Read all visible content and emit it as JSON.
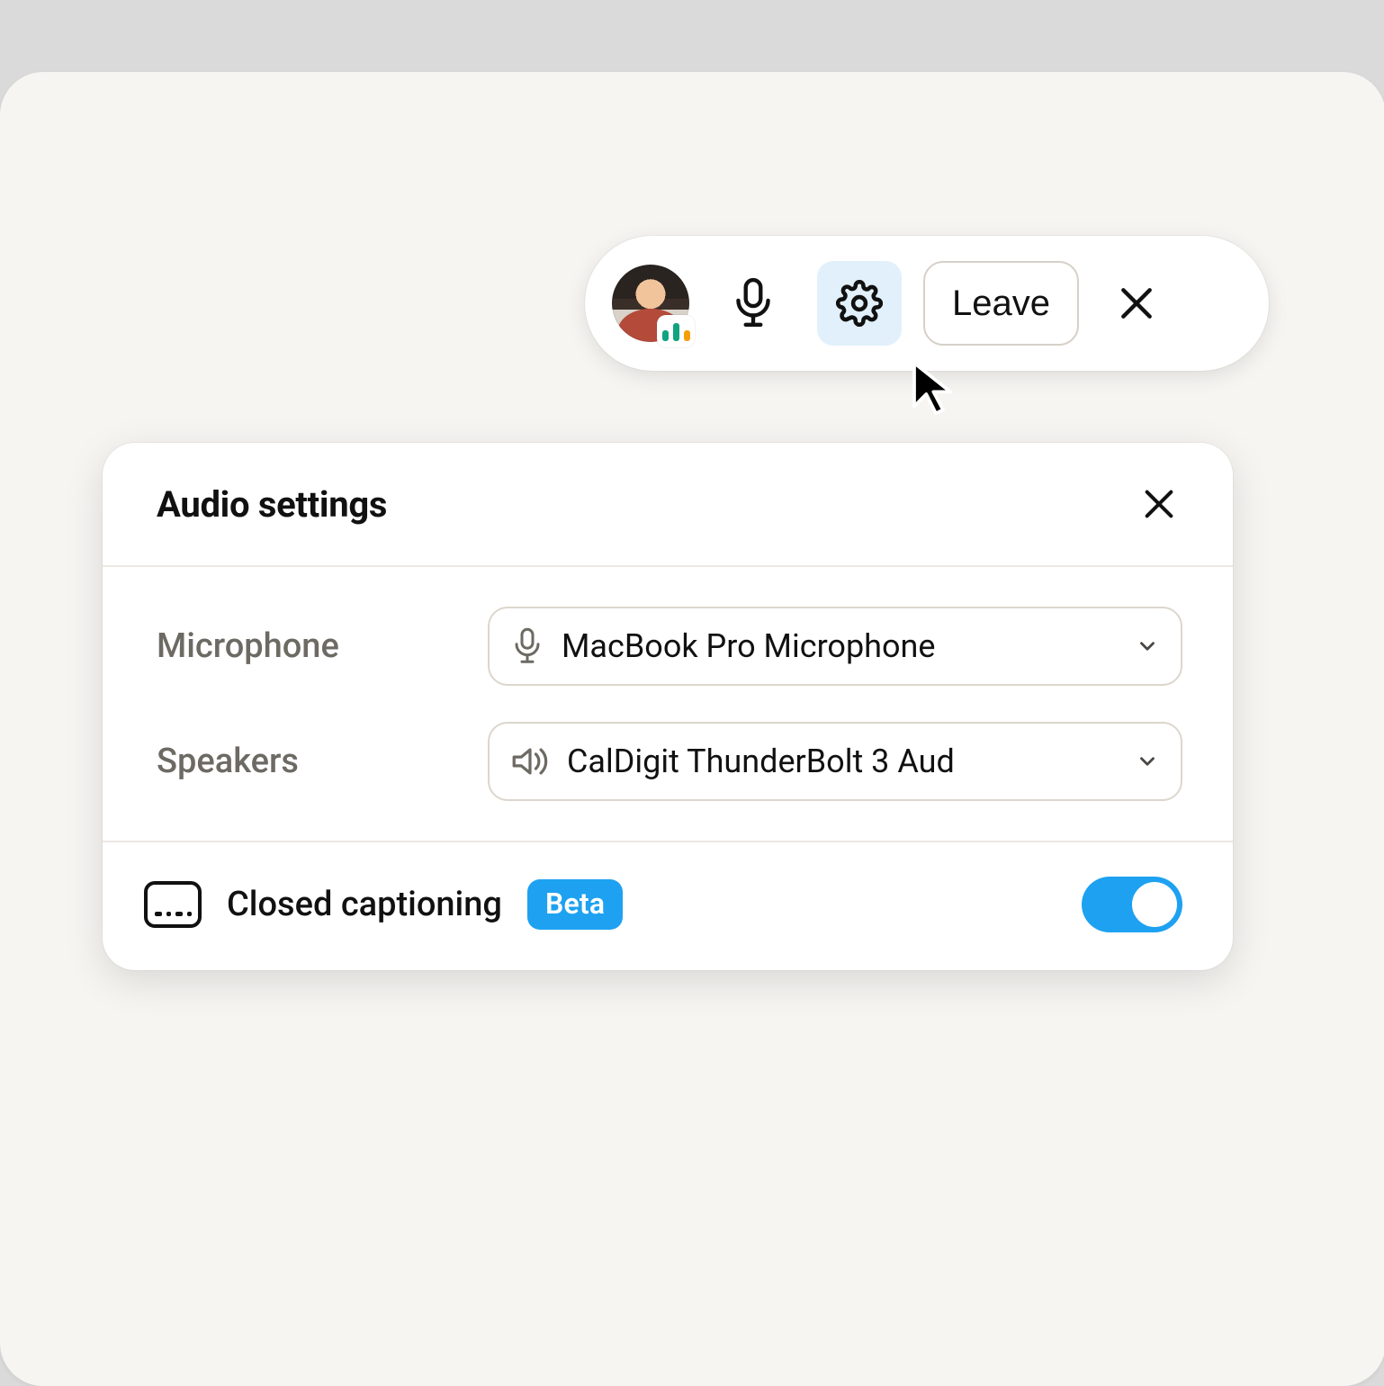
{
  "toolbar": {
    "leave_label": "Leave"
  },
  "panel": {
    "title": "Audio settings",
    "microphone": {
      "label": "Microphone",
      "value": "MacBook Pro Microphone"
    },
    "speakers": {
      "label": "Speakers",
      "value": "CalDigit ThunderBolt 3 Aud"
    },
    "captioning": {
      "label": "Closed captioning",
      "badge": "Beta",
      "enabled": true
    }
  }
}
